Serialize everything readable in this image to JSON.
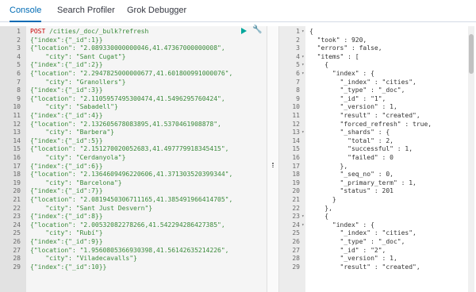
{
  "tabs": [
    {
      "label": "Console",
      "active": true
    },
    {
      "label": "Search Profiler",
      "active": false
    },
    {
      "label": "Grok Debugger",
      "active": false
    }
  ],
  "request": {
    "lines": [
      {
        "n": "1",
        "method": "POST",
        "url": " /cities/_doc/_bulk?refresh"
      },
      {
        "n": "2",
        "text": "{\"index\":{\"_id\":1}}"
      },
      {
        "n": "3",
        "text": "{\"location\": \"2.089330000000046,41.47367000000008\","
      },
      {
        "n": "4",
        "text": "    \"city\": \"Sant Cugat\"}"
      },
      {
        "n": "5",
        "text": "{\"index\":{\"_id\":2}}"
      },
      {
        "n": "6",
        "text": "{\"location\": \"2.2947825000000677,41.601800991000076\","
      },
      {
        "n": "7",
        "text": "    \"city\": \"Granollers\"}"
      },
      {
        "n": "8",
        "text": "{\"index\":{\"_id\":3}}"
      },
      {
        "n": "9",
        "text": "{\"location\": \"2.1105957495300474,41.5496295760424\","
      },
      {
        "n": "10",
        "text": "    \"city\": \"Sabadell\"}"
      },
      {
        "n": "11",
        "text": "{\"index\":{\"_id\":4}}"
      },
      {
        "n": "12",
        "text": "{\"location\": \"2.132605678083895,41.5370461908878\","
      },
      {
        "n": "13",
        "text": "    \"city\": \"Barbera\"}"
      },
      {
        "n": "14",
        "text": "{\"index\":{\"_id\":5}}"
      },
      {
        "n": "15",
        "text": "{\"location\": \"2.151270020052683,41.497779918345415\","
      },
      {
        "n": "16",
        "text": "    \"city\": \"Cerdanyola\"}"
      },
      {
        "n": "17",
        "text": "{\"index\":{\"_id\":6}}"
      },
      {
        "n": "18",
        "text": "{\"location\": \"2.1364609496220606,41.371303520399344\","
      },
      {
        "n": "19",
        "text": "    \"city\": \"Barcelona\"}"
      },
      {
        "n": "20",
        "text": "{\"index\":{\"_id\":7}}"
      },
      {
        "n": "21",
        "text": "{\"location\": \"2.0819450306711165,41.385491966414705\","
      },
      {
        "n": "22",
        "text": "    \"city\": \"Sant Just Desvern\"}"
      },
      {
        "n": "23",
        "text": "{\"index\":{\"_id\":8}}"
      },
      {
        "n": "24",
        "text": "{\"location\": \"2.00532082278266,41.542294286427385\","
      },
      {
        "n": "25",
        "text": "    \"city\": \"Rubí\"}"
      },
      {
        "n": "26",
        "text": "{\"index\":{\"_id\":9}}"
      },
      {
        "n": "27",
        "text": "{\"location\": \"1.9560805366930398,41.56142635214226\","
      },
      {
        "n": "28",
        "text": "    \"city\": \"Viladecavalls\"}"
      },
      {
        "n": "29",
        "text": "{\"index\":{\"_id\":10}}"
      }
    ]
  },
  "response": {
    "lines": [
      {
        "n": "1",
        "text": "{"
      },
      {
        "n": "2",
        "text": "  \"took\" : 920,"
      },
      {
        "n": "3",
        "text": "  \"errors\" : false,"
      },
      {
        "n": "4",
        "text": "  \"items\" : ["
      },
      {
        "n": "5",
        "text": "    {"
      },
      {
        "n": "6",
        "text": "      \"index\" : {"
      },
      {
        "n": "7",
        "text": "        \"_index\" : \"cities\","
      },
      {
        "n": "8",
        "text": "        \"_type\" : \"_doc\","
      },
      {
        "n": "9",
        "text": "        \"_id\" : \"1\","
      },
      {
        "n": "10",
        "text": "        \"_version\" : 1,"
      },
      {
        "n": "11",
        "text": "        \"result\" : \"created\","
      },
      {
        "n": "12",
        "text": "        \"forced_refresh\" : true,"
      },
      {
        "n": "13",
        "text": "        \"_shards\" : {"
      },
      {
        "n": "14",
        "text": "          \"total\" : 2,"
      },
      {
        "n": "15",
        "text": "          \"successful\" : 1,"
      },
      {
        "n": "16",
        "text": "          \"failed\" : 0"
      },
      {
        "n": "17",
        "text": "        },"
      },
      {
        "n": "18",
        "text": "        \"_seq_no\" : 0,"
      },
      {
        "n": "19",
        "text": "        \"_primary_term\" : 1,"
      },
      {
        "n": "20",
        "text": "        \"status\" : 201"
      },
      {
        "n": "21",
        "text": "      }"
      },
      {
        "n": "22",
        "text": "    },"
      },
      {
        "n": "23",
        "text": "    {"
      },
      {
        "n": "24",
        "text": "      \"index\" : {"
      },
      {
        "n": "25",
        "text": "        \"_index\" : \"cities\","
      },
      {
        "n": "26",
        "text": "        \"_type\" : \"_doc\","
      },
      {
        "n": "27",
        "text": "        \"_id\" : \"2\","
      },
      {
        "n": "28",
        "text": "        \"_version\" : 1,"
      },
      {
        "n": "29",
        "text": "        \"result\" : \"created\","
      }
    ],
    "fold_lines": [
      "1",
      "4",
      "5",
      "6",
      "13",
      "23",
      "24"
    ]
  },
  "icons": {
    "run": "play-icon",
    "settings": "wrench-icon"
  },
  "colors": {
    "accent": "#006bb4",
    "run": "#00a69b",
    "method": "#c80000",
    "string": "#3a8a3a"
  }
}
